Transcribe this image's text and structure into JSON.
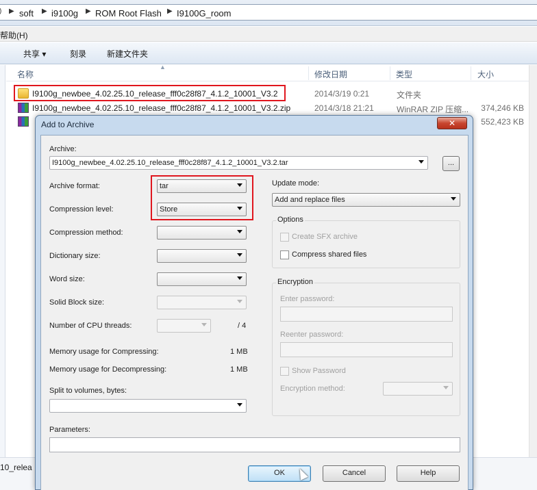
{
  "address_bar": {
    "crumbs": [
      "soft",
      "i9100g",
      "ROM Root Flash",
      "I9100G_room"
    ]
  },
  "menu": {
    "help": "帮助(H)"
  },
  "toolbar": {
    "share": "共享 ▾",
    "burn": "刻录",
    "new_folder": "新建文件夹"
  },
  "columns": {
    "name": "名称",
    "modified": "修改日期",
    "type": "类型",
    "size": "大小"
  },
  "files": [
    {
      "name": "I9100g_newbee_4.02.25.10_release_fff0c28f87_4.1.2_10001_V3.2",
      "date": "2014/3/19 0:21",
      "type": "文件夹",
      "size": "",
      "icon": "folder-icon"
    },
    {
      "name": "I9100g_newbee_4.02.25.10_release_fff0c28f87_4.1.2_10001_V3.2.zip",
      "date": "2014/3/18 21:21",
      "type": "WinRAR ZIP 压缩...",
      "size": "374,246 KB",
      "icon": "rar-icon"
    },
    {
      "name": "",
      "date": "",
      "type": "",
      "size": "552,423 KB",
      "icon": "rar-icon"
    }
  ],
  "status_bar": {
    "text": "10_relea"
  },
  "dialog": {
    "title": "Add to Archive",
    "close_label": "✕",
    "archive_label": "Archive:",
    "archive_value": "I9100g_newbee_4.02.25.10_release_fff0c28f87_4.1.2_10001_V3.2.tar",
    "browse_label": "...",
    "archive_format_label": "Archive format:",
    "archive_format_value": "tar",
    "compression_level_label": "Compression level:",
    "compression_level_value": "Store",
    "compression_method_label": "Compression method:",
    "dictionary_size_label": "Dictionary size:",
    "word_size_label": "Word size:",
    "solid_block_label": "Solid Block size:",
    "cpu_threads_label": "Number of CPU threads:",
    "cpu_threads_total": "/ 4",
    "mem_compress_label": "Memory usage for Compressing:",
    "mem_compress_value": "1 MB",
    "mem_decompress_label": "Memory usage for Decompressing:",
    "mem_decompress_value": "1 MB",
    "split_label": "Split to volumes, bytes:",
    "parameters_label": "Parameters:",
    "update_mode_label": "Update mode:",
    "update_mode_value": "Add and replace files",
    "options_title": "Options",
    "create_sfx_label": "Create SFX archive",
    "compress_shared_label": "Compress shared files",
    "encryption_title": "Encryption",
    "enter_password_label": "Enter password:",
    "reenter_password_label": "Reenter password:",
    "show_password_label": "Show Password",
    "encryption_method_label": "Encryption method:",
    "ok_label": "OK",
    "cancel_label": "Cancel",
    "help_label": "Help"
  },
  "colors": {
    "highlight": "#e0161e",
    "accent": "#3c7fb1"
  }
}
